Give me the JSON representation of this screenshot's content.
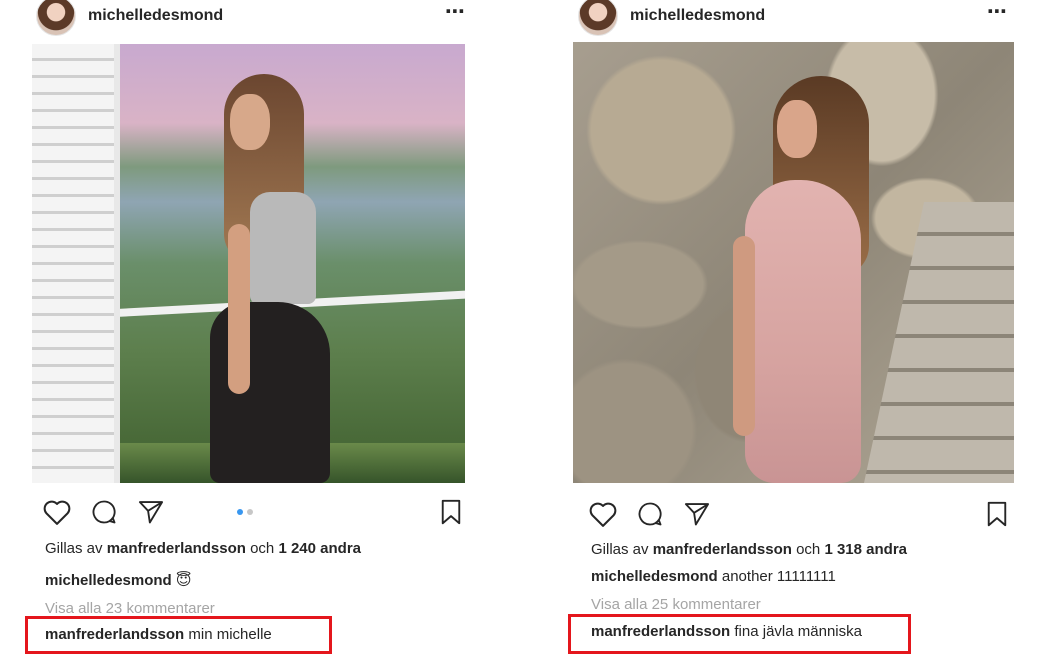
{
  "posts": [
    {
      "username": "michelledesmond",
      "more_icon": "⋯",
      "carousel_total": 2,
      "carousel_active_index": 0,
      "likes": {
        "prefix": "Gillas av",
        "user": "manfrederlandsson",
        "middle": "och",
        "count": "1 240 andra"
      },
      "caption": {
        "user": "michelledesmond",
        "text": "😇"
      },
      "view_comments": "Visa alla 23 kommentarer",
      "comment": {
        "user": "manfrederlandsson",
        "text": "min michelle"
      }
    },
    {
      "username": "michelledesmond",
      "more_icon": "⋯",
      "likes": {
        "prefix": "Gillas av",
        "user": "manfrederlandsson",
        "middle": "och",
        "count": "1 318 andra"
      },
      "caption": {
        "user": "michelledesmond",
        "text": "another 11111111"
      },
      "view_comments": "Visa alla 25 kommentarer",
      "comment": {
        "user": "manfrederlandsson",
        "text": "fina jävla människa"
      }
    }
  ],
  "icons": {
    "like": "heart-icon",
    "comment": "comment-icon",
    "share": "send-icon",
    "save": "bookmark-icon",
    "more": "more-options-icon"
  },
  "colors": {
    "text": "#262626",
    "muted": "#a5a5a5",
    "highlight": "#e4161c",
    "carousel_active": "#3897f0"
  }
}
